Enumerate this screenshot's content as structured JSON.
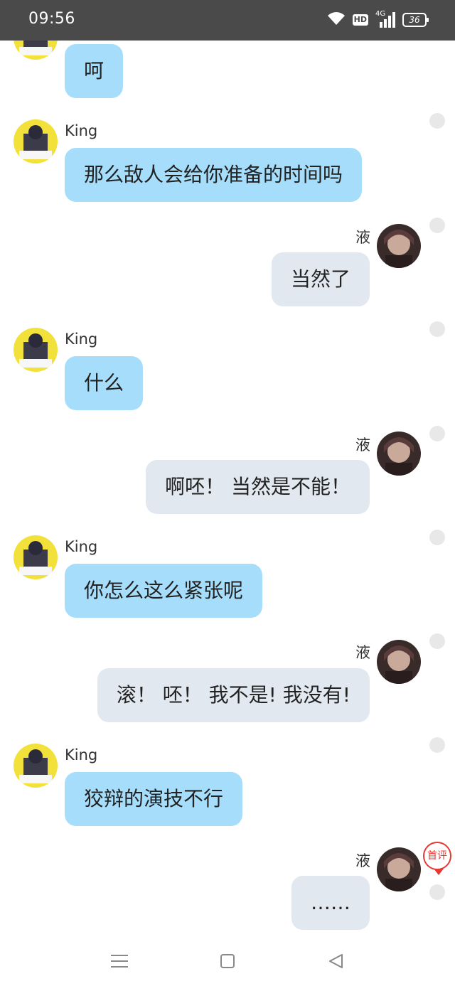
{
  "status_bar": {
    "time": "09:56",
    "hd_label": "HD",
    "network_label": "4G",
    "battery_level": "36"
  },
  "contacts": {
    "them": {
      "name": "King",
      "bubble_color": "#a5ddfb"
    },
    "me": {
      "name": "液",
      "bubble_color": "#e2e8ef"
    }
  },
  "messages": [
    {
      "sender": "King",
      "text": "呵"
    },
    {
      "sender": "King",
      "text": "那么敌人会给你准备的时间吗"
    },
    {
      "sender": "液",
      "text": "当然了"
    },
    {
      "sender": "King",
      "text": "什么"
    },
    {
      "sender": "液",
      "text": "啊呸！ 当然是不能！"
    },
    {
      "sender": "King",
      "text": "你怎么这么紧张呢"
    },
    {
      "sender": "液",
      "text": "滚！ 呸！ 我不是! 我没有!"
    },
    {
      "sender": "King",
      "text": "狡辩的演技不行"
    },
    {
      "sender": "液",
      "text": "……"
    }
  ],
  "first_comment_badge": "首评",
  "nav": [
    "menu-icon",
    "home-square-icon",
    "back-triangle-icon"
  ]
}
